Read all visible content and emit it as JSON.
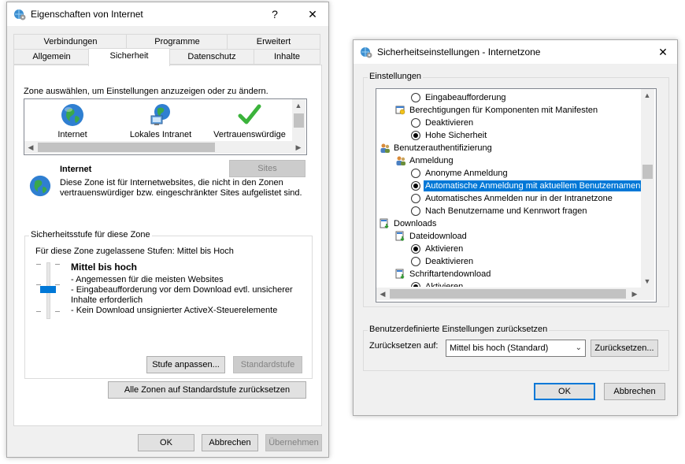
{
  "left_window": {
    "title": "Eigenschaften von Internet",
    "help_label": "?",
    "close_label": "✕",
    "tabs_row1": [
      "Verbindungen",
      "Programme",
      "Erweitert"
    ],
    "tabs_row2": [
      "Allgemein",
      "Sicherheit",
      "Datenschutz",
      "Inhalte"
    ],
    "zone_instruction": "Zone auswählen, um Einstellungen anzuzeigen oder zu ändern.",
    "zones": [
      {
        "label": "Internet",
        "icon": "globe-icon"
      },
      {
        "label": "Lokales Intranet",
        "icon": "intranet-icon"
      },
      {
        "label": "Vertrauenswürdige",
        "icon": "checkmark-icon"
      }
    ],
    "sites_button": "Sites",
    "zone_name": "Internet",
    "zone_description": "Diese Zone ist für Internetwebsites, die nicht in den Zonen vertrauenswürdiger bzw. eingeschränkter Sites aufgelistet sind.",
    "security_group_label": "Sicherheitsstufe für diese Zone",
    "allowed_levels": "Für diese Zone zugelassene Stufen: Mittel bis Hoch",
    "level_title": "Mittel bis hoch",
    "level_details": [
      "- Angemessen für die meisten Websites",
      "- Eingabeaufforderung vor dem Download evtl. unsicherer Inhalte erforderlich",
      "- Kein Download unsignierter ActiveX-Steuerelemente"
    ],
    "customize_button": "Stufe anpassen...",
    "default_level_button": "Standardstufe",
    "reset_all_button": "Alle Zonen auf Standardstufe zurücksetzen",
    "ok_button": "OK",
    "cancel_button": "Abbrechen",
    "apply_button": "Übernehmen"
  },
  "right_window": {
    "title": "Sicherheitseinstellungen - Internetzone",
    "close_label": "✕",
    "settings_group_label": "Einstellungen",
    "tree_items": [
      {
        "type": "radio",
        "label": "Eingabeaufforderung",
        "checked": false,
        "indent": 2
      },
      {
        "type": "category",
        "label": "Berechtigungen für Komponenten mit Manifesten",
        "indent": 1
      },
      {
        "type": "radio",
        "label": "Deaktivieren",
        "checked": false,
        "indent": 2
      },
      {
        "type": "radio",
        "label": "Hohe Sicherheit",
        "checked": true,
        "indent": 2
      },
      {
        "type": "category",
        "label": "Benutzerauthentifizierung",
        "indent": 0
      },
      {
        "type": "category",
        "label": "Anmeldung",
        "indent": 1
      },
      {
        "type": "radio",
        "label": "Anonyme Anmeldung",
        "checked": false,
        "indent": 2
      },
      {
        "type": "radio",
        "label": "Automatische Anmeldung mit aktuellem Benutzernamen u",
        "checked": true,
        "indent": 2,
        "selected": true
      },
      {
        "type": "radio",
        "label": "Automatisches Anmelden nur in der Intranetzone",
        "checked": false,
        "indent": 2
      },
      {
        "type": "radio",
        "label": "Nach Benutzername und Kennwort fragen",
        "checked": false,
        "indent": 2
      },
      {
        "type": "category",
        "label": "Downloads",
        "indent": 0
      },
      {
        "type": "category",
        "label": "Dateidownload",
        "indent": 1
      },
      {
        "type": "radio",
        "label": "Aktivieren",
        "checked": true,
        "indent": 2
      },
      {
        "type": "radio",
        "label": "Deaktivieren",
        "checked": false,
        "indent": 2
      },
      {
        "type": "category",
        "label": "Schriftartendownload",
        "indent": 1
      },
      {
        "type": "radio",
        "label": "Aktivieren",
        "checked": true,
        "indent": 2
      }
    ],
    "reset_group_label": "Benutzerdefinierte Einstellungen zurücksetzen",
    "reset_to_label": "Zurücksetzen auf:",
    "reset_select_value": "Mittel bis hoch (Standard)",
    "reset_button": "Zurücksetzen...",
    "ok_button": "OK",
    "cancel_button": "Abbrechen"
  },
  "colors": {
    "selection": "#0078d7",
    "button_face": "#e1e1e1",
    "dialog_bg": "#f0f0f0"
  }
}
